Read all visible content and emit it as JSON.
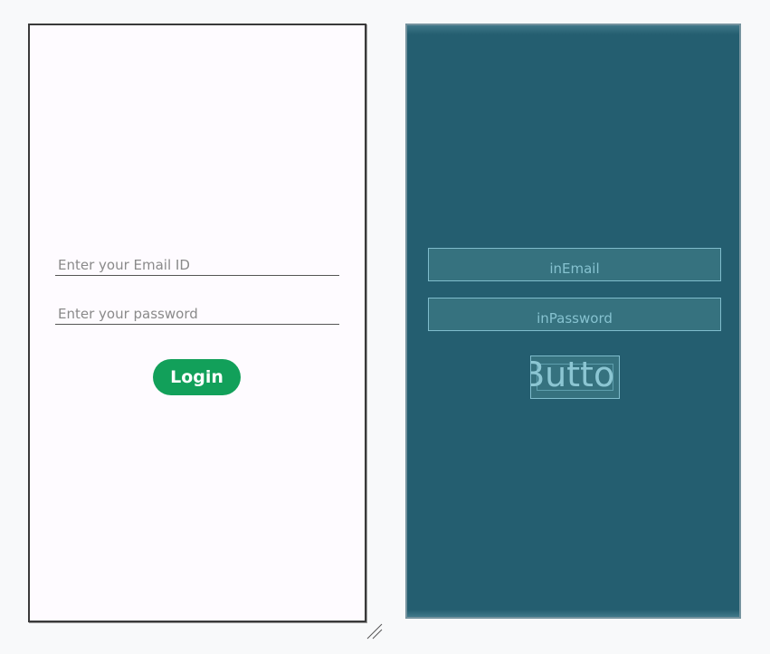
{
  "design_preview": {
    "email_field": {
      "placeholder": "Enter your Email ID",
      "value": ""
    },
    "password_field": {
      "placeholder": "Enter your password",
      "value": ""
    },
    "login_button": {
      "label": "Login",
      "color": "#12a05a"
    }
  },
  "blueprint_view": {
    "email_box": {
      "label": "inEmail"
    },
    "password_box": {
      "label": "inPassword"
    },
    "button_box": {
      "label": "Butto"
    },
    "background_color": "#245e70"
  },
  "icons": {
    "resize_handle": "resize-grip-icon"
  }
}
